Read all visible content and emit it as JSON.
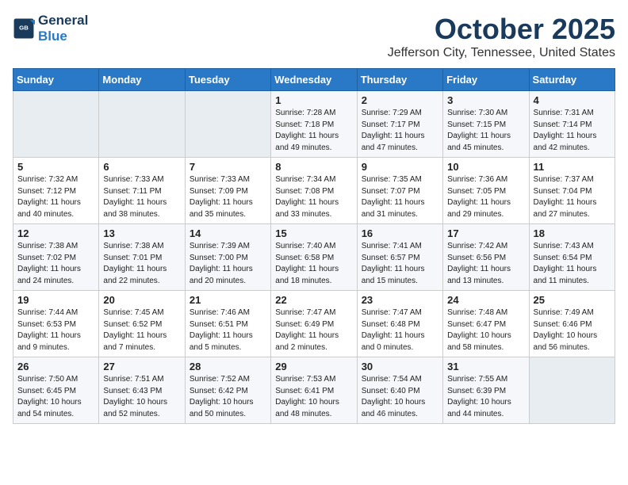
{
  "header": {
    "logo_line1": "General",
    "logo_line2": "Blue",
    "title": "October 2025",
    "subtitle": "Jefferson City, Tennessee, United States"
  },
  "weekdays": [
    "Sunday",
    "Monday",
    "Tuesday",
    "Wednesday",
    "Thursday",
    "Friday",
    "Saturday"
  ],
  "weeks": [
    [
      {
        "day": "",
        "sunrise": "",
        "sunset": "",
        "daylight": ""
      },
      {
        "day": "",
        "sunrise": "",
        "sunset": "",
        "daylight": ""
      },
      {
        "day": "",
        "sunrise": "",
        "sunset": "",
        "daylight": ""
      },
      {
        "day": "1",
        "sunrise": "Sunrise: 7:28 AM",
        "sunset": "Sunset: 7:18 PM",
        "daylight": "Daylight: 11 hours and 49 minutes."
      },
      {
        "day": "2",
        "sunrise": "Sunrise: 7:29 AM",
        "sunset": "Sunset: 7:17 PM",
        "daylight": "Daylight: 11 hours and 47 minutes."
      },
      {
        "day": "3",
        "sunrise": "Sunrise: 7:30 AM",
        "sunset": "Sunset: 7:15 PM",
        "daylight": "Daylight: 11 hours and 45 minutes."
      },
      {
        "day": "4",
        "sunrise": "Sunrise: 7:31 AM",
        "sunset": "Sunset: 7:14 PM",
        "daylight": "Daylight: 11 hours and 42 minutes."
      }
    ],
    [
      {
        "day": "5",
        "sunrise": "Sunrise: 7:32 AM",
        "sunset": "Sunset: 7:12 PM",
        "daylight": "Daylight: 11 hours and 40 minutes."
      },
      {
        "day": "6",
        "sunrise": "Sunrise: 7:33 AM",
        "sunset": "Sunset: 7:11 PM",
        "daylight": "Daylight: 11 hours and 38 minutes."
      },
      {
        "day": "7",
        "sunrise": "Sunrise: 7:33 AM",
        "sunset": "Sunset: 7:09 PM",
        "daylight": "Daylight: 11 hours and 35 minutes."
      },
      {
        "day": "8",
        "sunrise": "Sunrise: 7:34 AM",
        "sunset": "Sunset: 7:08 PM",
        "daylight": "Daylight: 11 hours and 33 minutes."
      },
      {
        "day": "9",
        "sunrise": "Sunrise: 7:35 AM",
        "sunset": "Sunset: 7:07 PM",
        "daylight": "Daylight: 11 hours and 31 minutes."
      },
      {
        "day": "10",
        "sunrise": "Sunrise: 7:36 AM",
        "sunset": "Sunset: 7:05 PM",
        "daylight": "Daylight: 11 hours and 29 minutes."
      },
      {
        "day": "11",
        "sunrise": "Sunrise: 7:37 AM",
        "sunset": "Sunset: 7:04 PM",
        "daylight": "Daylight: 11 hours and 27 minutes."
      }
    ],
    [
      {
        "day": "12",
        "sunrise": "Sunrise: 7:38 AM",
        "sunset": "Sunset: 7:02 PM",
        "daylight": "Daylight: 11 hours and 24 minutes."
      },
      {
        "day": "13",
        "sunrise": "Sunrise: 7:38 AM",
        "sunset": "Sunset: 7:01 PM",
        "daylight": "Daylight: 11 hours and 22 minutes."
      },
      {
        "day": "14",
        "sunrise": "Sunrise: 7:39 AM",
        "sunset": "Sunset: 7:00 PM",
        "daylight": "Daylight: 11 hours and 20 minutes."
      },
      {
        "day": "15",
        "sunrise": "Sunrise: 7:40 AM",
        "sunset": "Sunset: 6:58 PM",
        "daylight": "Daylight: 11 hours and 18 minutes."
      },
      {
        "day": "16",
        "sunrise": "Sunrise: 7:41 AM",
        "sunset": "Sunset: 6:57 PM",
        "daylight": "Daylight: 11 hours and 15 minutes."
      },
      {
        "day": "17",
        "sunrise": "Sunrise: 7:42 AM",
        "sunset": "Sunset: 6:56 PM",
        "daylight": "Daylight: 11 hours and 13 minutes."
      },
      {
        "day": "18",
        "sunrise": "Sunrise: 7:43 AM",
        "sunset": "Sunset: 6:54 PM",
        "daylight": "Daylight: 11 hours and 11 minutes."
      }
    ],
    [
      {
        "day": "19",
        "sunrise": "Sunrise: 7:44 AM",
        "sunset": "Sunset: 6:53 PM",
        "daylight": "Daylight: 11 hours and 9 minutes."
      },
      {
        "day": "20",
        "sunrise": "Sunrise: 7:45 AM",
        "sunset": "Sunset: 6:52 PM",
        "daylight": "Daylight: 11 hours and 7 minutes."
      },
      {
        "day": "21",
        "sunrise": "Sunrise: 7:46 AM",
        "sunset": "Sunset: 6:51 PM",
        "daylight": "Daylight: 11 hours and 5 minutes."
      },
      {
        "day": "22",
        "sunrise": "Sunrise: 7:47 AM",
        "sunset": "Sunset: 6:49 PM",
        "daylight": "Daylight: 11 hours and 2 minutes."
      },
      {
        "day": "23",
        "sunrise": "Sunrise: 7:47 AM",
        "sunset": "Sunset: 6:48 PM",
        "daylight": "Daylight: 11 hours and 0 minutes."
      },
      {
        "day": "24",
        "sunrise": "Sunrise: 7:48 AM",
        "sunset": "Sunset: 6:47 PM",
        "daylight": "Daylight: 10 hours and 58 minutes."
      },
      {
        "day": "25",
        "sunrise": "Sunrise: 7:49 AM",
        "sunset": "Sunset: 6:46 PM",
        "daylight": "Daylight: 10 hours and 56 minutes."
      }
    ],
    [
      {
        "day": "26",
        "sunrise": "Sunrise: 7:50 AM",
        "sunset": "Sunset: 6:45 PM",
        "daylight": "Daylight: 10 hours and 54 minutes."
      },
      {
        "day": "27",
        "sunrise": "Sunrise: 7:51 AM",
        "sunset": "Sunset: 6:43 PM",
        "daylight": "Daylight: 10 hours and 52 minutes."
      },
      {
        "day": "28",
        "sunrise": "Sunrise: 7:52 AM",
        "sunset": "Sunset: 6:42 PM",
        "daylight": "Daylight: 10 hours and 50 minutes."
      },
      {
        "day": "29",
        "sunrise": "Sunrise: 7:53 AM",
        "sunset": "Sunset: 6:41 PM",
        "daylight": "Daylight: 10 hours and 48 minutes."
      },
      {
        "day": "30",
        "sunrise": "Sunrise: 7:54 AM",
        "sunset": "Sunset: 6:40 PM",
        "daylight": "Daylight: 10 hours and 46 minutes."
      },
      {
        "day": "31",
        "sunrise": "Sunrise: 7:55 AM",
        "sunset": "Sunset: 6:39 PM",
        "daylight": "Daylight: 10 hours and 44 minutes."
      },
      {
        "day": "",
        "sunrise": "",
        "sunset": "",
        "daylight": ""
      }
    ]
  ]
}
